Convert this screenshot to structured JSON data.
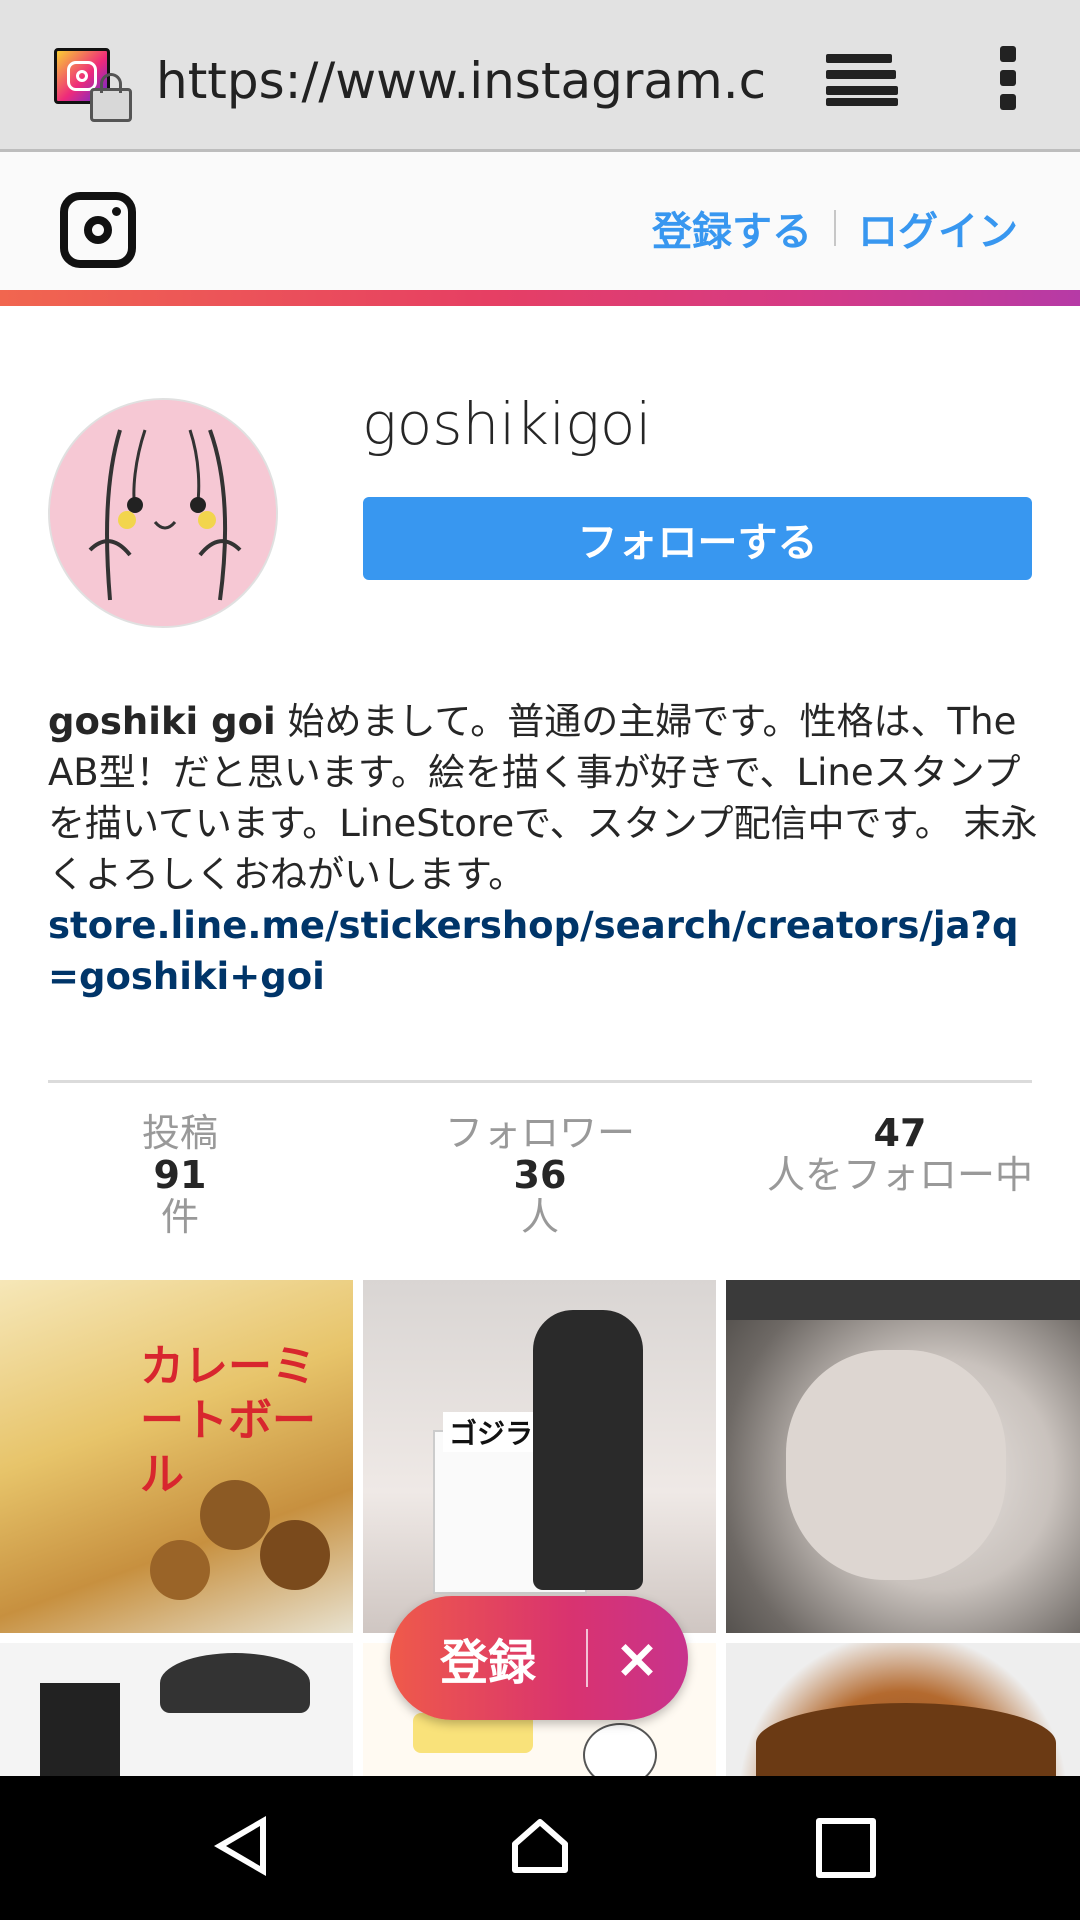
{
  "browser": {
    "url": "https://www.instagram.cc",
    "tabs_icon": "tabs-icon",
    "menu_icon": "overflow-menu-icon"
  },
  "header": {
    "logo_icon": "instagram-logo-icon",
    "signup_label": "登録する",
    "login_label": "ログイン"
  },
  "profile": {
    "username": "goshikigoi",
    "follow_label": "フォローする",
    "bio_name": "goshiki goi",
    "bio_text": " 始めまして。普通の主婦です。性格は、The　AB型！だと思います。絵を描く事が好きで、Lineスタンプを描いています。LineStoreで、スタンプ配信中です。 末永くよろしくおねがいします。",
    "bio_link": "store.line.me/stickershop/search/creators/ja?q=goshiki+goi"
  },
  "stats": {
    "posts_label": "投稿",
    "posts_count": "91",
    "posts_unit": "件",
    "followers_label": "フォロワー",
    "followers_count": "36",
    "followers_unit": "人",
    "following_count": "47",
    "following_label": "人をフォロー中"
  },
  "grid": {
    "cell1_text": "カレーミートボール",
    "cell2_text": "ゴジラ"
  },
  "signup_popup": {
    "label": "登録",
    "close": "×"
  },
  "colors": {
    "accent": "#3897f0",
    "link": "#003569",
    "gradient_start": "#f1664f",
    "gradient_end": "#b63aa6"
  }
}
